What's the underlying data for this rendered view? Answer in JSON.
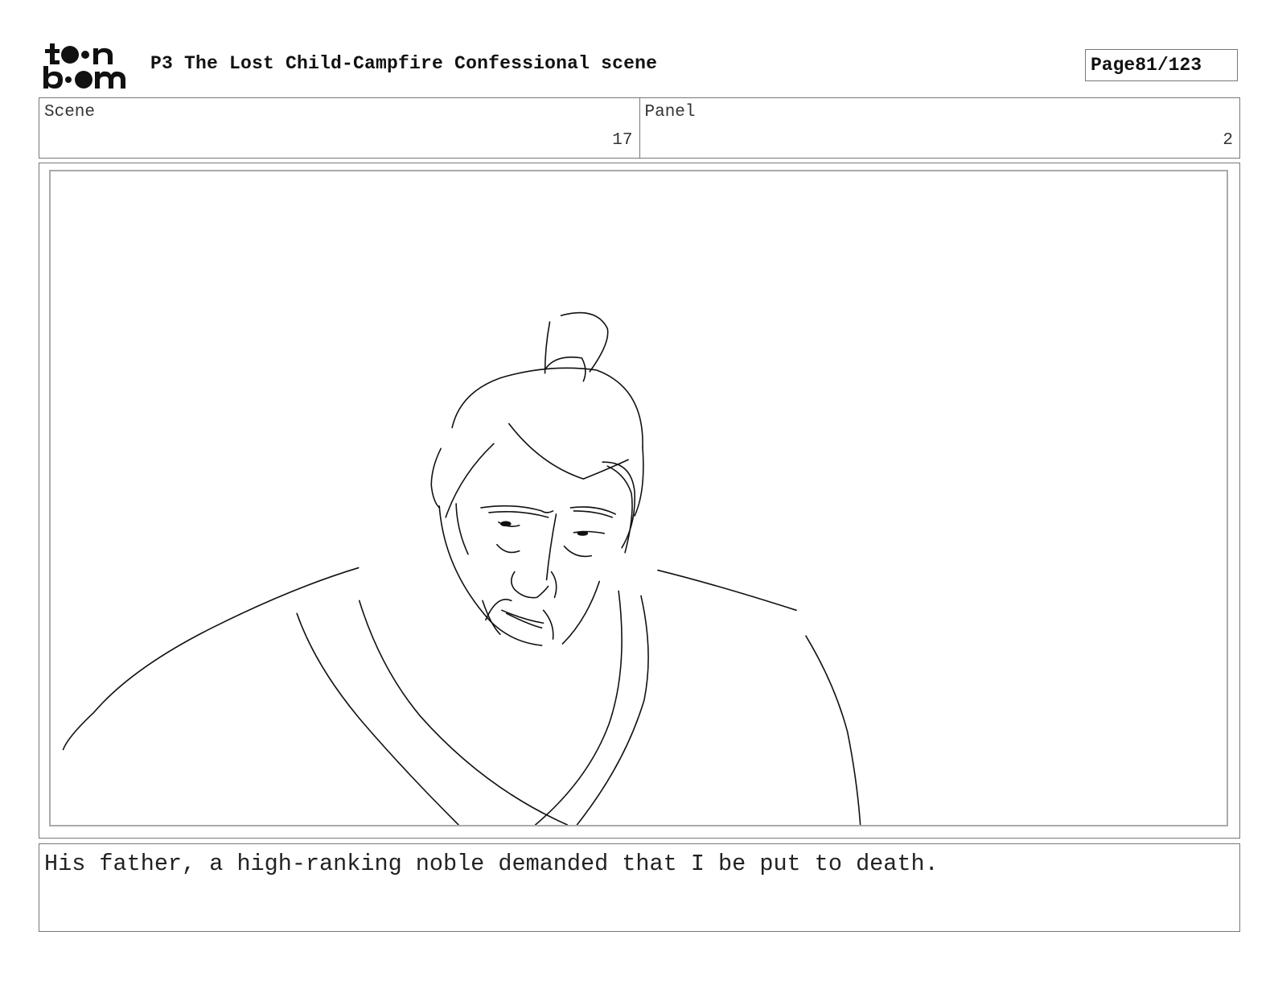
{
  "header": {
    "logo_text": "toon boom",
    "title": "P3 The Lost Child-Campfire Confessional scene",
    "page_label": "Page",
    "page_value": "81/123"
  },
  "info": {
    "scene_label": "Scene",
    "scene_value": "17",
    "panel_label": "Panel",
    "panel_value": "2"
  },
  "panel": {
    "image_icon": "storyboard-sketch-icon"
  },
  "dialog": {
    "text": "His father, a high-ranking noble demanded that I be put to death."
  }
}
